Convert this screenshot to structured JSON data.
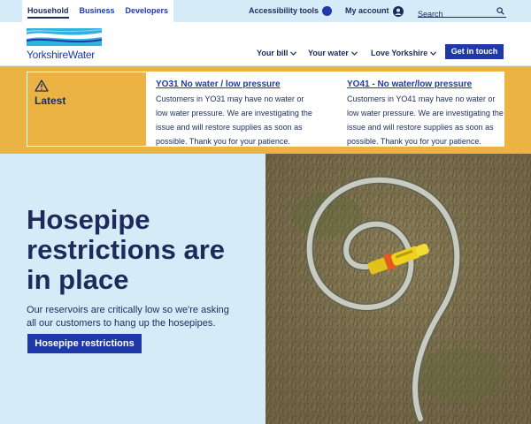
{
  "topbar": {
    "tabs": [
      {
        "label": "Household",
        "active": true
      },
      {
        "label": "Business",
        "active": false
      },
      {
        "label": "Developers",
        "active": false
      }
    ],
    "accessibility_label": "Accessibility tools",
    "account_label": "My account",
    "search_placeholder": "Search"
  },
  "header": {
    "logo_text": "YorkshireWater",
    "nav": [
      "Your bill",
      "Your water",
      "Love Yorkshire"
    ],
    "cta_label": "Get in touch"
  },
  "latest": {
    "title": "Latest",
    "notices": [
      {
        "link": "YO31 No water / low pressure",
        "body": "Customers in YO31 may have no water or low water pressure. We are investigating the issue and will restore supplies as soon as possible. Thank you for your patience."
      },
      {
        "link": "YO41 - No water/low pressure",
        "body": "Customers in YO41 may have no water or low water pressure. We are investigating the issue and will restore supplies as soon as possible. Thank you for your patience."
      }
    ]
  },
  "hero": {
    "title": "Hosepipe restrictions are in place",
    "text": "Our reservoirs are critically low so we're asking all our customers to hang up the hosepipes.",
    "cta_label": "Hosepipe restrictions"
  },
  "colors": {
    "brand_blue": "#1f3aa8",
    "navy": "#1d2b5a",
    "light_blue": "#d6ebf8",
    "amber": "#ebb343"
  }
}
